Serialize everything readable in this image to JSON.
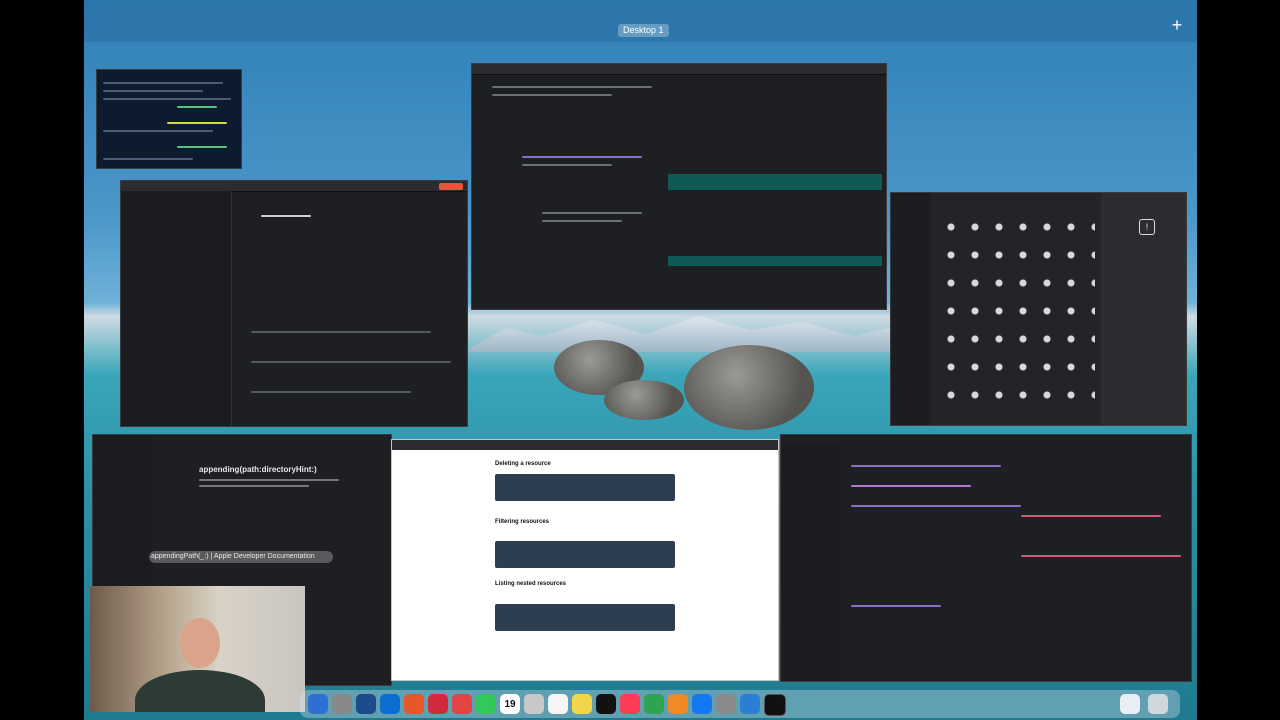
{
  "mission_control": {
    "desktop_label": "Desktop 1"
  },
  "editor_bottom_left": {
    "heading": "appending(path:directoryHint:)",
    "link_text": "appendingPath(_:) | Apple Developer Documentation"
  },
  "browser_doc": {
    "sections": [
      "Deleting a resource",
      "Filtering resources",
      "Listing nested resources"
    ]
  },
  "dock": {
    "calendar_day": "19",
    "apps": [
      "finder-icon",
      "launchpad-icon",
      "safari-icon",
      "messages-icon",
      "mail-icon",
      "maps-icon",
      "photos-icon",
      "facetime-icon",
      "calendar-icon",
      "contacts-icon",
      "reminders-icon",
      "notes-icon",
      "tv-icon",
      "music-icon",
      "numbers-icon",
      "pages-icon",
      "app-store-icon",
      "system-settings-icon",
      "xcode-icon",
      "terminal-icon",
      "downloads-icon",
      "trash-icon"
    ]
  }
}
